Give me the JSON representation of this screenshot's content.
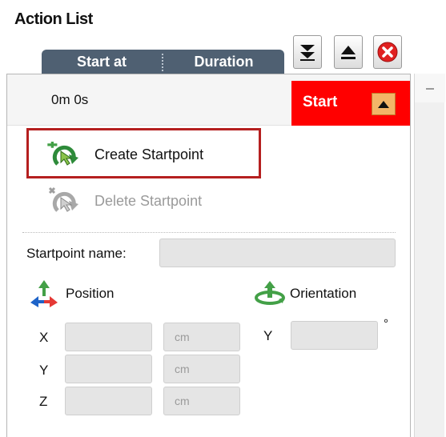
{
  "panel": {
    "title": "Action List"
  },
  "columns": {
    "start_at": "Start at",
    "duration": "Duration"
  },
  "toolbar": {
    "move_down_icon": "double-down-arrow-icon",
    "move_up_icon": "eject-up-icon",
    "close_icon": "red-close-icon"
  },
  "row": {
    "time": "0m 0s",
    "start_label": "Start",
    "start_color": "#ff0000"
  },
  "actions": {
    "create": "Create Startpoint",
    "delete": "Delete Startpoint"
  },
  "form": {
    "name_label": "Startpoint name:",
    "name_value": "",
    "position_label": "Position",
    "orientation_label": "Orientation",
    "x_label": "X",
    "y_label": "Y",
    "z_label": "Z",
    "orient_y_label": "Y",
    "unit": "cm",
    "degree": "°",
    "x_value": "",
    "y_value": "",
    "z_value": "",
    "orient_y_value": ""
  },
  "colors": {
    "header_bg": "#4f6072",
    "highlight": "#b51f1f"
  }
}
